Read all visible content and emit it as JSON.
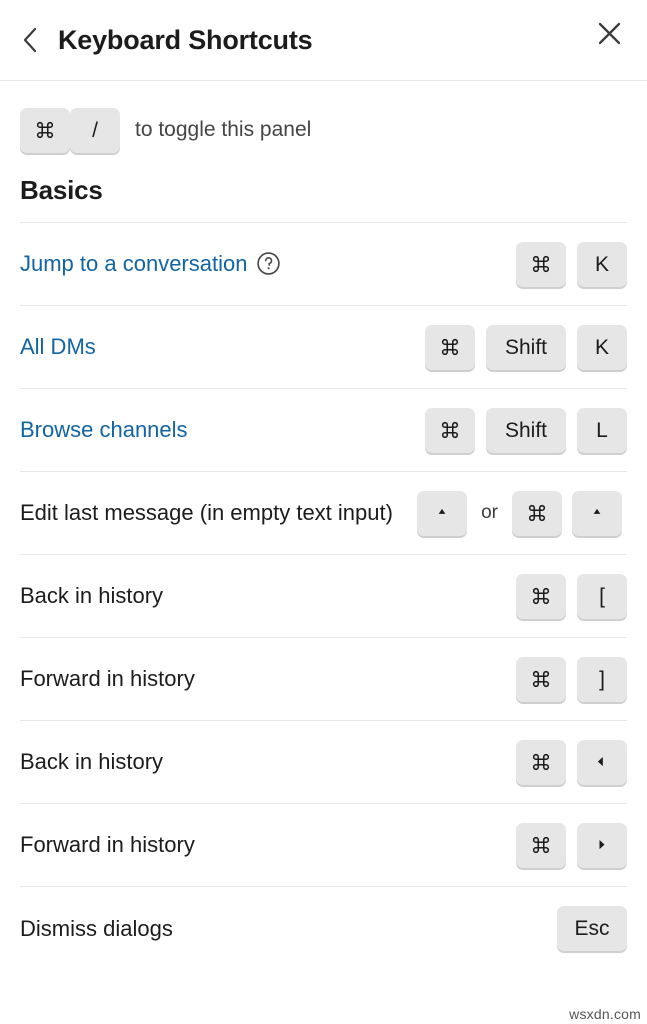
{
  "header": {
    "title": "Keyboard Shortcuts",
    "back_icon": "chevron-left-icon",
    "close_icon": "close-icon"
  },
  "toggle_hint": {
    "keys": [
      "⌘",
      "/"
    ],
    "text": "to toggle this panel"
  },
  "section": {
    "title": "Basics",
    "rows": [
      {
        "label": "Jump to a conversation",
        "is_link": true,
        "has_help_icon": true,
        "keys": [
          {
            "label": "⌘",
            "type": "cmd"
          },
          {
            "label": "K",
            "type": "char"
          }
        ]
      },
      {
        "label": "All DMs",
        "is_link": true,
        "has_help_icon": false,
        "keys": [
          {
            "label": "⌘",
            "type": "cmd"
          },
          {
            "label": "Shift",
            "type": "wide"
          },
          {
            "label": "K",
            "type": "char"
          }
        ]
      },
      {
        "label": "Browse channels",
        "is_link": true,
        "has_help_icon": false,
        "keys": [
          {
            "label": "⌘",
            "type": "cmd"
          },
          {
            "label": "Shift",
            "type": "wide"
          },
          {
            "label": "L",
            "type": "char"
          }
        ]
      },
      {
        "label": "Edit last message (in empty text input)",
        "is_link": false,
        "has_help_icon": false,
        "keys": [
          {
            "label": "▲",
            "type": "arrow-up"
          },
          {
            "label": "or",
            "type": "separator"
          },
          {
            "label": "⌘",
            "type": "cmd"
          },
          {
            "label": "▲",
            "type": "arrow-up"
          }
        ]
      },
      {
        "label": "Back in history",
        "is_link": false,
        "has_help_icon": false,
        "keys": [
          {
            "label": "⌘",
            "type": "cmd"
          },
          {
            "label": "[",
            "type": "char"
          }
        ]
      },
      {
        "label": "Forward in history",
        "is_link": false,
        "has_help_icon": false,
        "keys": [
          {
            "label": "⌘",
            "type": "cmd"
          },
          {
            "label": "]",
            "type": "char"
          }
        ]
      },
      {
        "label": "Back in history",
        "is_link": false,
        "has_help_icon": false,
        "keys": [
          {
            "label": "⌘",
            "type": "cmd"
          },
          {
            "label": "◀",
            "type": "arrow-left"
          }
        ]
      },
      {
        "label": "Forward in history",
        "is_link": false,
        "has_help_icon": false,
        "keys": [
          {
            "label": "⌘",
            "type": "cmd"
          },
          {
            "label": "▶",
            "type": "arrow-right"
          }
        ]
      },
      {
        "label": "Dismiss dialogs",
        "is_link": false,
        "has_help_icon": false,
        "keys": [
          {
            "label": "Esc",
            "type": "esc"
          }
        ]
      }
    ]
  },
  "watermark": "wsxdn.com",
  "colors": {
    "link": "#1264a3",
    "text": "#1d1c1d",
    "key_bg": "#e6e6e6",
    "key_shadow": "#cfcfcf",
    "divider": "#e8e8e8"
  }
}
